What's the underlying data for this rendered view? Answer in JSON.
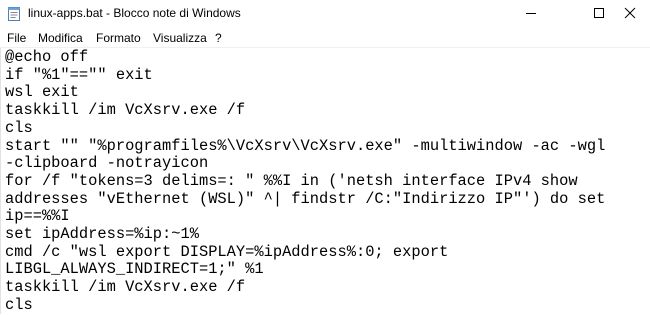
{
  "window": {
    "title": "linux-apps.bat - Blocco note di Windows",
    "app_icon": "notepad-icon",
    "controls": {
      "minimize_icon": "minimize-icon",
      "maximize_icon": "maximize-icon",
      "close_icon": "close-icon"
    }
  },
  "menu": {
    "items": [
      "File",
      "Modifica",
      "Formato",
      "Visualizza",
      "?"
    ]
  },
  "editor": {
    "lines": [
      "@echo off",
      "if \"%1\"==\"\" exit",
      "wsl exit",
      "taskkill /im VcXsrv.exe /f",
      "cls",
      "start \"\" \"%programfiles%\\VcXsrv\\VcXsrv.exe\" -multiwindow -ac -wgl",
      "-clipboard -notrayicon",
      "for /f \"tokens=3 delims=: \" %%I in ('netsh interface IPv4 show",
      "addresses \"vEthernet (WSL)\" ^| findstr /C:\"Indirizzo IP\"') do set",
      "ip==%%I",
      "set ipAddress=%ip:~1%",
      "cmd /c \"wsl export DISPLAY=%ipAddress%:0; export",
      "LIBGL_ALWAYS_INDIRECT=1;\" %1",
      "taskkill /im VcXsrv.exe /f",
      "cls"
    ]
  }
}
